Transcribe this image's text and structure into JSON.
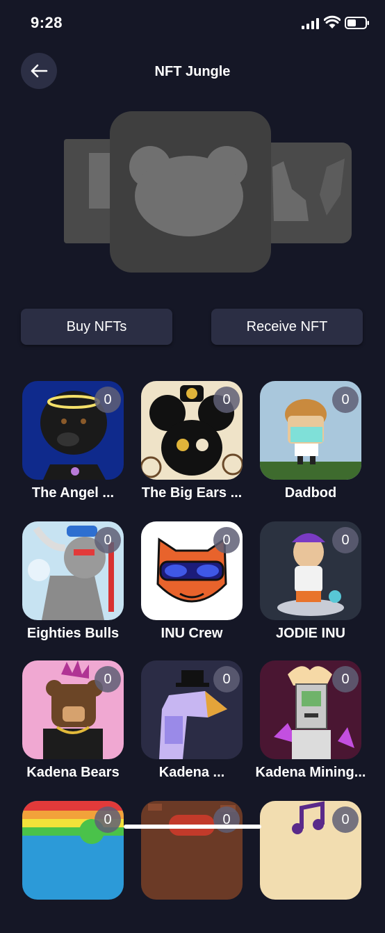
{
  "status_bar": {
    "time": "9:28"
  },
  "header": {
    "title": "NFT Jungle"
  },
  "actions": {
    "buy_label": "Buy NFTs",
    "receive_label": "Receive NFT"
  },
  "collections": [
    {
      "name": "The Angel ...",
      "count": "0"
    },
    {
      "name": "The Big Ears ...",
      "count": "0"
    },
    {
      "name": "Dadbod",
      "count": "0"
    },
    {
      "name": "Eighties Bulls",
      "count": "0"
    },
    {
      "name": "INU Crew",
      "count": "0"
    },
    {
      "name": "JODIE INU",
      "count": "0"
    },
    {
      "name": "Kadena Bears",
      "count": "0"
    },
    {
      "name": "Kadena ...",
      "count": "0"
    },
    {
      "name": "Kadena Mining...",
      "count": "0"
    },
    {
      "name": "",
      "count": "0"
    },
    {
      "name": "",
      "count": "0"
    },
    {
      "name": "",
      "count": "0"
    }
  ],
  "colors": {
    "background": "#151726",
    "button": "#2b2e44",
    "back_button": "#2c2f45",
    "badge": "#5f5f76"
  }
}
